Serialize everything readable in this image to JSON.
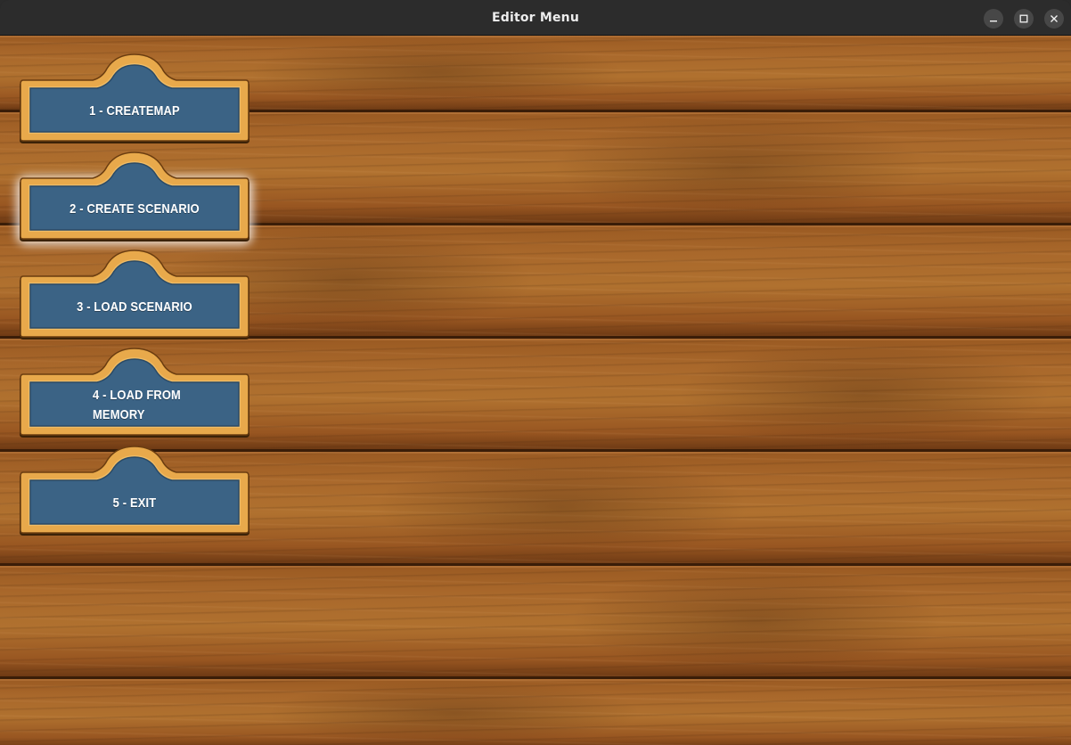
{
  "window": {
    "title": "Editor Menu"
  },
  "controls": {
    "minimize_icon": "minimize-icon",
    "maximize_icon": "maximize-icon",
    "close_icon": "close-icon"
  },
  "colors": {
    "button_fill": "#3b6385",
    "button_border": "#e7a84a",
    "wood": "#a9682b",
    "selected_glow": "#ffffff"
  },
  "menu": {
    "items": [
      {
        "label": "1 - CREATEMAP",
        "selected": false
      },
      {
        "label": "2 - CREATE SCENARIO",
        "selected": true
      },
      {
        "label": "3 - LOAD SCENARIO",
        "selected": false
      },
      {
        "label": "4 - LOAD FROM MEMORY",
        "selected": false
      },
      {
        "label": "5 - EXIT",
        "selected": false
      }
    ]
  }
}
